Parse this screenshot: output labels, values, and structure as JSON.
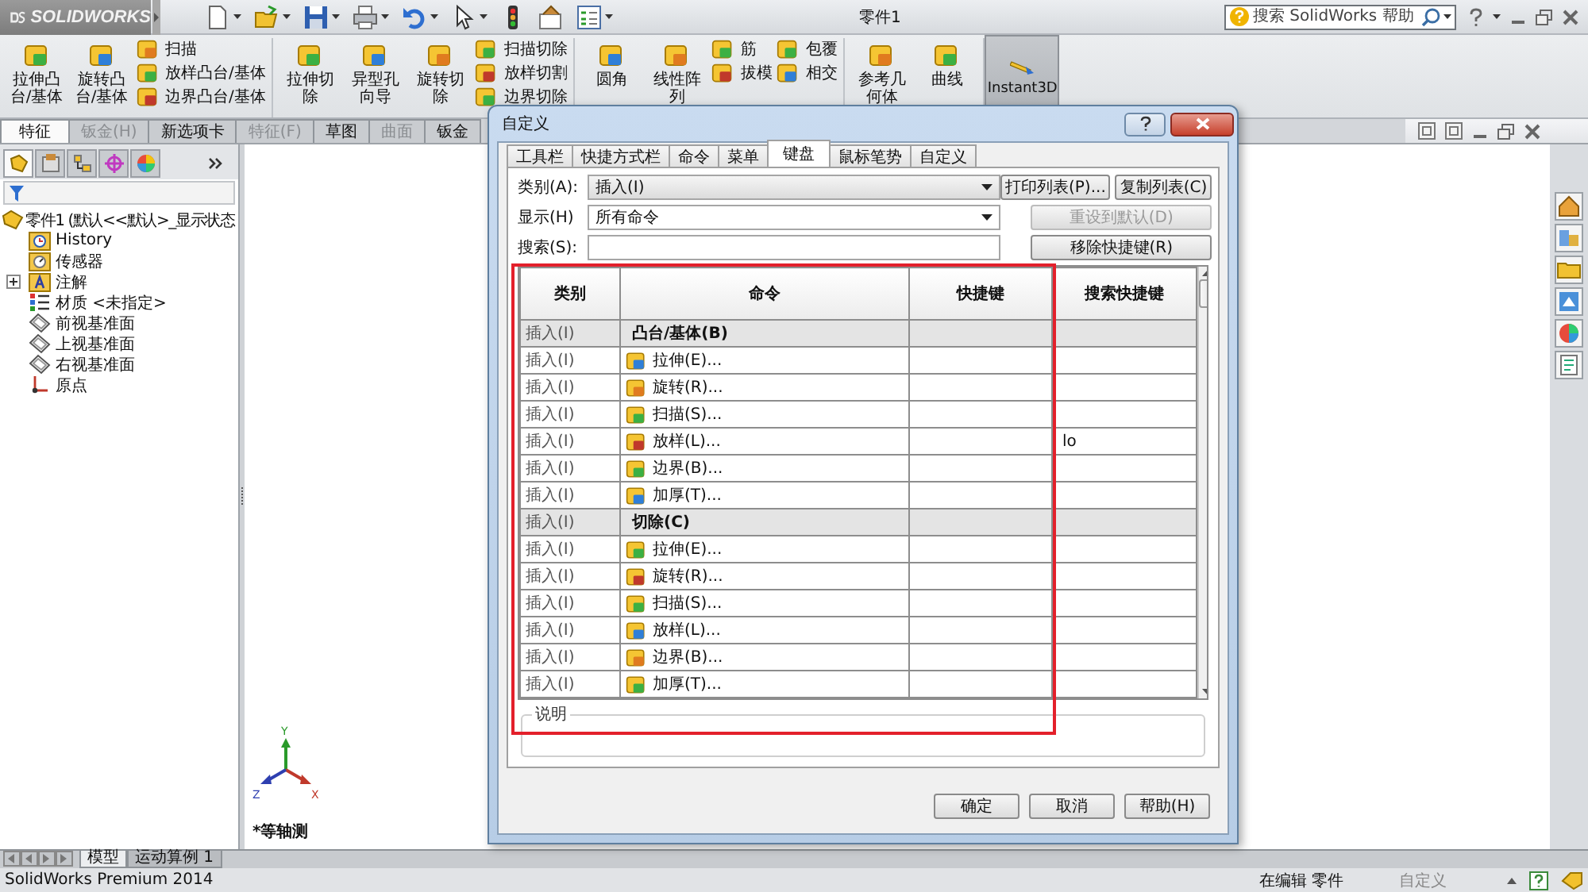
{
  "app": {
    "logo": "SOLIDWORKS",
    "title": "零件1",
    "search_placeholder": "搜索 SolidWorks 帮助"
  },
  "ribbon": {
    "groups": [
      {
        "large": [
          {
            "lines": [
              "拉伸凸",
              "台/基体"
            ]
          },
          {
            "lines": [
              "旋转凸",
              "台/基体"
            ]
          }
        ],
        "small": [
          [
            "扫描",
            "放样凸台/基体",
            "边界凸台/基体"
          ]
        ]
      },
      {
        "large": [
          {
            "lines": [
              "拉伸切",
              "除"
            ]
          },
          {
            "lines": [
              "异型孔",
              "向导"
            ]
          },
          {
            "lines": [
              "旋转切",
              "除"
            ]
          }
        ],
        "small": [
          [
            "扫描切除",
            "放样切割",
            "边界切除"
          ]
        ]
      },
      {
        "large": [
          {
            "lines": [
              "圆角"
            ]
          },
          {
            "lines": [
              "线性阵",
              "列"
            ]
          }
        ],
        "small": [
          [
            "筋",
            "拔模"
          ],
          [
            "包覆",
            "相交"
          ]
        ]
      },
      {
        "large": [
          {
            "lines": [
              "参考几",
              "何体"
            ]
          },
          {
            "lines": [
              "曲线"
            ]
          }
        ]
      }
    ],
    "instant3d": {
      "label": "Instant3D",
      "on": true
    }
  },
  "command_tabs": [
    {
      "label": "特征",
      "selected": true,
      "disabled": false
    },
    {
      "label": "钣金(H)",
      "selected": false,
      "disabled": true
    },
    {
      "label": "新选项卡",
      "selected": false,
      "disabled": false
    },
    {
      "label": "特征(F)",
      "selected": false,
      "disabled": true
    },
    {
      "label": "草图",
      "selected": false,
      "disabled": false
    },
    {
      "label": "曲面",
      "selected": false,
      "disabled": true
    },
    {
      "label": "钣金",
      "selected": false,
      "disabled": false
    }
  ],
  "feature_manager_tabs": [
    {
      "selected": true
    },
    {
      "selected": false
    },
    {
      "selected": false
    },
    {
      "selected": false
    },
    {
      "selected": false
    }
  ],
  "feature_tree": {
    "root": "零件1 (默认<<默认>_显示状态",
    "children": [
      {
        "label": "History",
        "kind": "history",
        "collapsed": false
      },
      {
        "label": "传感器",
        "kind": "sensor",
        "collapsed": false
      },
      {
        "label": "注解",
        "kind": "annotation",
        "collapsed": true
      },
      {
        "label": "材质 <未指定>",
        "kind": "material",
        "collapsed": false
      },
      {
        "label": "前视基准面",
        "kind": "plane",
        "collapsed": false
      },
      {
        "label": "上视基准面",
        "kind": "plane",
        "collapsed": false
      },
      {
        "label": "右视基准面",
        "kind": "plane",
        "collapsed": false
      },
      {
        "label": "原点",
        "kind": "origin",
        "collapsed": false
      }
    ]
  },
  "viewport": {
    "view_name": "*等轴测",
    "axis_labels": {
      "x": "X",
      "y": "Y",
      "z": "Z"
    }
  },
  "bottom_tabs": [
    {
      "label": "模型",
      "selected": true
    },
    {
      "label": "运动算例 1",
      "selected": false
    }
  ],
  "status_bar": {
    "product": "SolidWorks Premium 2014",
    "mode": "在编辑 零件",
    "units": "自定义"
  },
  "dialog": {
    "title": "自定义",
    "tabs": [
      {
        "label": "工具栏",
        "selected": false
      },
      {
        "label": "快捷方式栏",
        "selected": false
      },
      {
        "label": "命令",
        "selected": false
      },
      {
        "label": "菜单",
        "selected": false
      },
      {
        "label": "键盘",
        "selected": true
      },
      {
        "label": "鼠标笔势",
        "selected": false
      },
      {
        "label": "自定义",
        "selected": false
      }
    ],
    "fields": [
      {
        "label": "类别(A):",
        "kind": "select",
        "value": "插入(I)"
      },
      {
        "label": "显示(H)",
        "kind": "select",
        "value": "所有命令"
      },
      {
        "label": "搜索(S):",
        "kind": "text"
      }
    ],
    "side_buttons": [
      {
        "label": "打印列表(P)...",
        "disabled": false
      },
      {
        "label": "复制列表(C)",
        "disabled": false
      },
      {
        "label": "重设到默认(D)",
        "disabled": true
      },
      {
        "label": "移除快捷键(R)",
        "disabled": false
      }
    ],
    "table": {
      "columns": [
        "类别",
        "命令",
        "快捷键",
        "搜索快捷键"
      ],
      "rows": [
        {
          "kind": "group",
          "category": "插入(I)",
          "command": "凸台/基体(B)"
        },
        {
          "kind": "item",
          "category": "插入(I)",
          "command": "拉伸(E)..."
        },
        {
          "kind": "item",
          "category": "插入(I)",
          "command": "旋转(R)..."
        },
        {
          "kind": "item",
          "category": "插入(I)",
          "command": "扫描(S)..."
        },
        {
          "kind": "item",
          "category": "插入(I)",
          "command": "放样(L)...",
          "search_shortcut": "lo"
        },
        {
          "kind": "item",
          "category": "插入(I)",
          "command": "边界(B)..."
        },
        {
          "kind": "item",
          "category": "插入(I)",
          "command": "加厚(T)..."
        },
        {
          "kind": "group",
          "category": "插入(I)",
          "command": "切除(C)"
        },
        {
          "kind": "item",
          "category": "插入(I)",
          "command": "拉伸(E)..."
        },
        {
          "kind": "item",
          "category": "插入(I)",
          "command": "旋转(R)..."
        },
        {
          "kind": "item",
          "category": "插入(I)",
          "command": "扫描(S)..."
        },
        {
          "kind": "item",
          "category": "插入(I)",
          "command": "放样(L)..."
        },
        {
          "kind": "item",
          "category": "插入(I)",
          "command": "边界(B)..."
        },
        {
          "kind": "item",
          "category": "插入(I)",
          "command": "加厚(T)..."
        }
      ]
    },
    "description_label": "说明",
    "buttons": [
      "确定",
      "取消",
      "帮助(H)"
    ]
  }
}
